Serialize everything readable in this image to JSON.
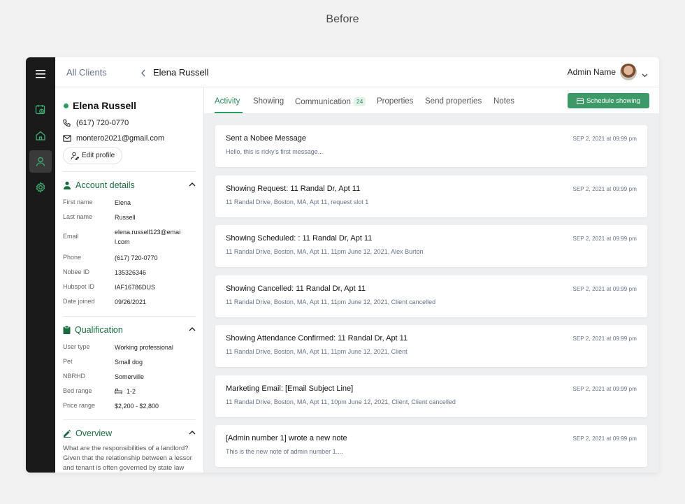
{
  "caption": "Before",
  "breadcrumb": {
    "parent": "All Clients",
    "current": "Elena Russell"
  },
  "header": {
    "admin_name": "Admin Name"
  },
  "profile": {
    "name": "Elena Russell",
    "phone": "(617) 720-0770",
    "email": "montero2021@gmail.com",
    "edit_label": "Edit profile"
  },
  "account": {
    "title": "Account details",
    "rows": [
      {
        "k": "First name",
        "v": "Elena"
      },
      {
        "k": "Last name",
        "v": "Russell"
      },
      {
        "k": "Email",
        "v": "elena.russell123@emai l.com"
      },
      {
        "k": "Phone",
        "v": "(617) 720-0770"
      },
      {
        "k": "Nobee ID",
        "v": "135326346"
      },
      {
        "k": "Hubspot ID",
        "v": "IAF16786DUS"
      },
      {
        "k": "Date joined",
        "v": "09/26/2021"
      }
    ]
  },
  "qualification": {
    "title": "Qualification",
    "rows": [
      {
        "k": "User type",
        "v": "Working professional"
      },
      {
        "k": "Pet",
        "v": "Small dog"
      },
      {
        "k": "NBRHD",
        "v": "Somerville"
      },
      {
        "k": "Bed range",
        "v": "1-2"
      },
      {
        "k": "Price range",
        "v": "$2,200 - $2,800"
      }
    ]
  },
  "overview": {
    "title": "Overview",
    "text": "What are the responsibilities of a landlord? Given that the relationship between a lessor and tenant is often governed by state law"
  },
  "tabs": [
    {
      "label": "Activity",
      "active": true
    },
    {
      "label": "Showing"
    },
    {
      "label": "Communication",
      "badge": "24"
    },
    {
      "label": "Properties"
    },
    {
      "label": "Send properties"
    },
    {
      "label": "Notes"
    }
  ],
  "actions": {
    "schedule_label": "Schedule showing"
  },
  "activity": [
    {
      "title": "Sent a Nobee Message",
      "sub": "Hello, this is ricky's first message...",
      "date": "SEP 2, 2021 at 09:99 pm"
    },
    {
      "title": "Showing Request: 11 Randal Dr, Apt 11",
      "sub": "11 Randal Drive, Boston, MA, Apt 11, request slot 1",
      "date": "SEP 2, 2021 at 09:99 pm"
    },
    {
      "title": "Showing Scheduled: : 11 Randal Dr, Apt 11",
      "sub": "11 Randal Drive, Boston, MA, Apt 11, 11pm June 12, 2021, Alex Burton",
      "date": "SEP 2, 2021 at 09:99 pm"
    },
    {
      "title": "Showing Cancelled: 11 Randal Dr, Apt 11",
      "sub": "11 Randal Drive, Boston, MA, Apt 11, 11pm June 12, 2021, Client cancelled",
      "date": "SEP 2, 2021 at 09:99 pm"
    },
    {
      "title": "Showing Attendance Confirmed: 11 Randal Dr, Apt 11",
      "sub": "11 Randal Drive, Boston, MA, Apt 11, 11pm June 12, 2021, Client",
      "date": "SEP 2, 2021 at 09:99 pm"
    },
    {
      "title": "Marketing Email: [Email Subject Line]",
      "sub": "11 Randal Drive, Boston, MA, Apt 11, 10pm June 12, 2021, Client, Client cancelled",
      "date": "SEP 2, 2021 at 09:99 pm"
    },
    {
      "title": "[Admin number 1] wrote a new note",
      "sub": "This is the new note of admin number 1....",
      "date": "SEP 2, 2021 at 09:99 pm"
    }
  ],
  "colors": {
    "accent": "#2e9b62",
    "rail": "#1a1a1a",
    "feed_bg": "#eeeff1"
  }
}
